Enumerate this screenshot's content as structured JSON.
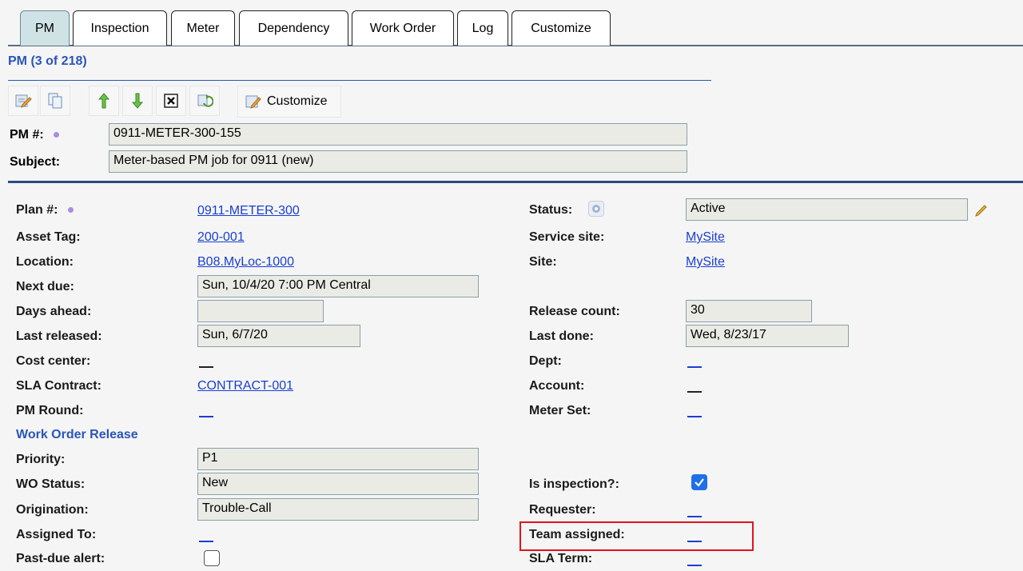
{
  "tabs": [
    "PM",
    "Inspection",
    "Meter",
    "Dependency",
    "Work Order",
    "Log",
    "Customize"
  ],
  "record_title": "PM (3 of 218)",
  "toolbar": {
    "customize_label": "Customize",
    "icons": [
      "edit-icon",
      "copy-icon",
      "arrow-up-icon",
      "arrow-down-icon",
      "close-box-icon",
      "refresh-icon",
      "customize-icon"
    ]
  },
  "header": {
    "pm_label": "PM #:",
    "pm_value": "0911-METER-300-155",
    "subject_label": "Subject:",
    "subject_value": "Meter-based PM job for 0911 (new)"
  },
  "left_fields": {
    "plan_label": "Plan #:",
    "plan_value": "0911-METER-300",
    "asset_label": "Asset Tag:",
    "asset_value": "200-001",
    "location_label": "Location:",
    "location_value": "B08.MyLoc-1000",
    "next_due_label": "Next due:",
    "next_due_value": "Sun, 10/4/20 7:00 PM Central",
    "days_ahead_label": "Days ahead:",
    "days_ahead_value": "",
    "last_released_label": "Last released:",
    "last_released_value": "Sun, 6/7/20",
    "cost_center_label": "Cost center:",
    "sla_contract_label": "SLA Contract:",
    "sla_contract_value": "CONTRACT-001",
    "pm_round_label": "PM Round:",
    "section_wo_release": "Work Order Release",
    "priority_label": "Priority:",
    "priority_value": "P1",
    "wo_status_label": "WO Status:",
    "wo_status_value": "New",
    "origination_label": "Origination:",
    "origination_value": "Trouble-Call",
    "assigned_to_label": "Assigned To:",
    "past_due_label": "Past-due alert:"
  },
  "right_fields": {
    "status_label": "Status:",
    "status_value": "Active",
    "service_site_label": "Service site:",
    "service_site_value": "MySite",
    "site_label": "Site:",
    "site_value": "MySite",
    "release_count_label": "Release count:",
    "release_count_value": "30",
    "last_done_label": "Last done:",
    "last_done_value": "Wed, 8/23/17",
    "dept_label": "Dept:",
    "account_label": "Account:",
    "meter_set_label": "Meter Set:",
    "is_inspection_label": "Is inspection?:",
    "is_inspection_checked": true,
    "requester_label": "Requester:",
    "team_assigned_label": "Team assigned:",
    "sla_term_label": "SLA Term:"
  },
  "past_due_checked": false,
  "colors": {
    "accent": "#2a56b8",
    "link": "#1a3fd1",
    "highlight": "#e0141c",
    "checkbox": "#1f6fe6"
  }
}
